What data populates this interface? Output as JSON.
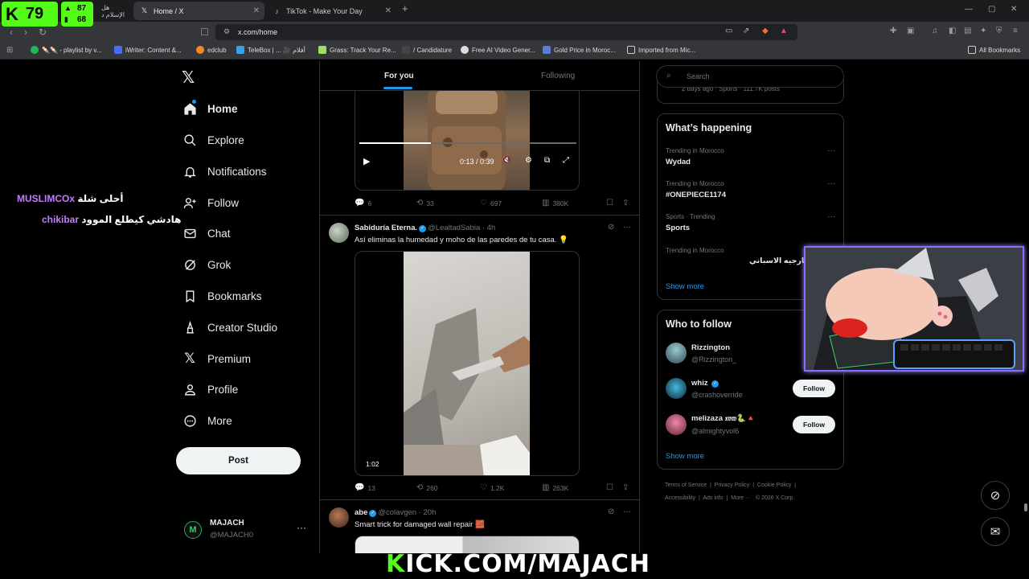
{
  "browser": {
    "tabs": [
      {
        "title": "هل الإسلام د",
        "icon": "arabic-tab-icon"
      },
      {
        "title": "Home / X",
        "icon": "x-tab-icon"
      },
      {
        "title": "TikTok - Make Your Day",
        "icon": "tiktok-tab-icon"
      }
    ],
    "new_tab": "+",
    "url": "x.com/home",
    "bookmarks": [
      "🍡🍡 - playlist by v...",
      "iWriter: Content &...",
      "edclub",
      "TeleBox | ... 🎥 أفلام",
      "Grass: Track Your Re...",
      "/ Candidature",
      "Free AI Video Gener...",
      "Gold Price in Moroc...",
      "Imported from Mic..."
    ],
    "all_bookmarks": "All Bookmarks"
  },
  "sidebar": {
    "items": [
      {
        "label": "Home",
        "icon": "home-icon"
      },
      {
        "label": "Explore",
        "icon": "search-icon"
      },
      {
        "label": "Notifications",
        "icon": "bell-icon"
      },
      {
        "label": "Follow",
        "icon": "person-add-icon"
      },
      {
        "label": "Chat",
        "icon": "mail-icon"
      },
      {
        "label": "Grok",
        "icon": "grok-icon"
      },
      {
        "label": "Bookmarks",
        "icon": "bookmark-icon"
      },
      {
        "label": "Creator Studio",
        "icon": "creator-icon"
      },
      {
        "label": "Premium",
        "icon": "x-icon"
      },
      {
        "label": "Profile",
        "icon": "person-icon"
      },
      {
        "label": "More",
        "icon": "more-circle-icon"
      }
    ],
    "post_label": "Post",
    "account": {
      "name": "MAJACH",
      "handle": "@MAJACH0"
    }
  },
  "timeline": {
    "tab_for_you": "For you",
    "tab_following": "Following",
    "top_post": {
      "video_time": "0:13 / 0:39",
      "replies": "6",
      "reposts": "33",
      "likes": "697",
      "views": "380K"
    },
    "post2": {
      "name": "Sabiduría Eterna.",
      "handle": "@LealtadSabia",
      "time": "4h",
      "text": "Así eliminas la humedad y moho de las paredes de tu casa. 💡",
      "duration": "1:02",
      "replies": "13",
      "reposts": "260",
      "likes": "1.2K",
      "views": "263K"
    },
    "post3": {
      "name": "abe",
      "handle": "@colavgen",
      "time": "20h",
      "text": "Smart trick for damaged wall repair 🧱"
    }
  },
  "right": {
    "search_placeholder": "Search",
    "prev_card_meta": "2 days ago · Sports · 111.7K posts",
    "whats_happening": "What’s happening",
    "trends": [
      {
        "context": "Trending in Morocco",
        "name": "Wydad"
      },
      {
        "context": "Trending in Morocco",
        "name": "#ONEPIECE1174"
      },
      {
        "context": "Sports · Trending",
        "name": "Sports"
      },
      {
        "context": "Trending in Morocco",
        "name": "وزير الخارجيه الاسباني"
      }
    ],
    "show_more": "Show more",
    "who_to_follow": "Who to follow",
    "wtf": [
      {
        "name": "Rizzington",
        "handle": "@Rizzington_"
      },
      {
        "name": "whiz",
        "handle": "@crashoverride"
      },
      {
        "name": "melizaza 𝔵𝔳𝔴🐍🔺",
        "handle": "@almightyvol6"
      }
    ],
    "follow_label": "Follow",
    "footer1": [
      "Terms of Service",
      "Privacy Policy",
      "Cookie Policy"
    ],
    "footer2": [
      "Accessibility",
      "Ads info",
      "More ···",
      "© 2026 X Corp."
    ]
  },
  "overlay": {
    "kick_count": "79",
    "stat_top": "87",
    "stat_bottom": "68",
    "ar_line1_a": "MUSLIMCOx",
    "ar_line1_b": "أحلى شلة",
    "ar_line2_a": "chikibar",
    "ar_line2_b": "هادشي كيطلع الموود",
    "kick_footer_a": "K",
    "kick_footer_b": "ICK.COM/MAJACH"
  },
  "colors": {
    "accent": "#1d9bf0",
    "kick_green": "#53fc18",
    "bg": "#000000",
    "border": "#2f3336"
  }
}
